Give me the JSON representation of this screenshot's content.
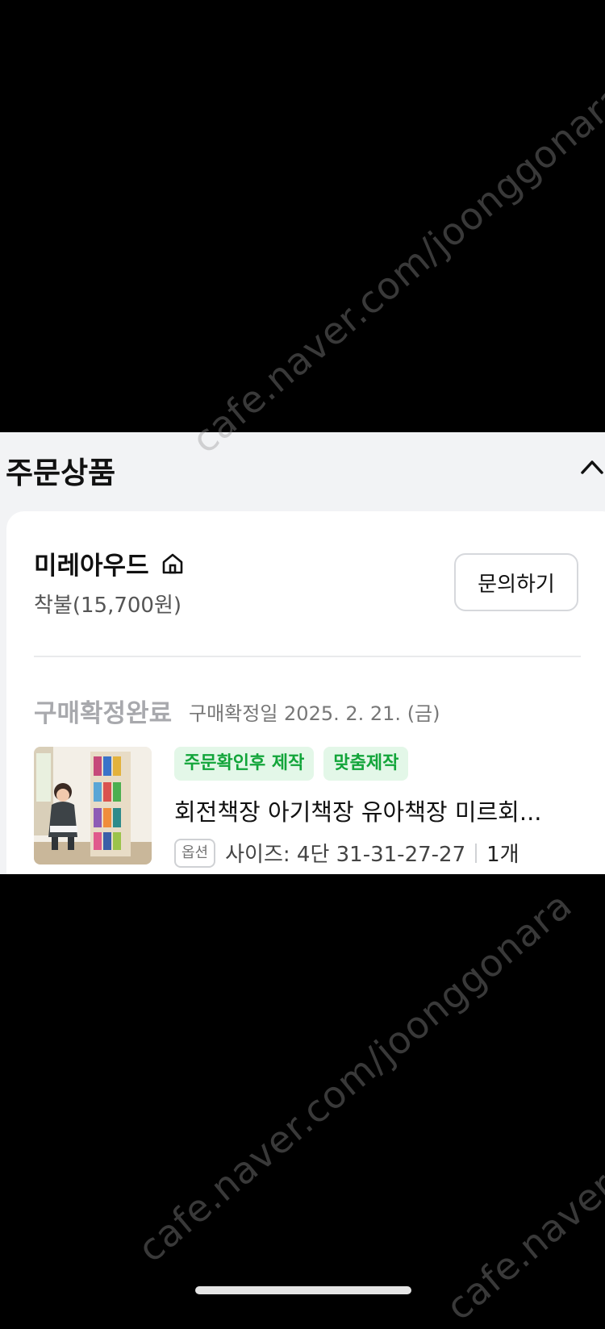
{
  "watermark": "cafe.naver.com/joonggonara",
  "section": {
    "title": "주문상품"
  },
  "seller": {
    "name": "미레아우드",
    "shipping": "착불(15,700원)",
    "inquiry_label": "문의하기"
  },
  "order": {
    "status": "구매확정완료",
    "confirm_date": "구매확정일 2025. 2. 21. (금)"
  },
  "product": {
    "tags": [
      "주문확인후 제작",
      "맞춤제작"
    ],
    "name": "회전책장 아기책장 유아책장 미르회...",
    "option_label": "옵션",
    "option_value": "사이즈: 4단 31-31-27-27",
    "quantity": "1개"
  },
  "colors": {
    "background": "#000000",
    "panel": "#f2f3f5",
    "tag_bg": "#e3f7e8",
    "tag_text": "#12a53a"
  },
  "icons": {
    "collapse": "chevron-up-icon",
    "store_home": "home-icon"
  }
}
